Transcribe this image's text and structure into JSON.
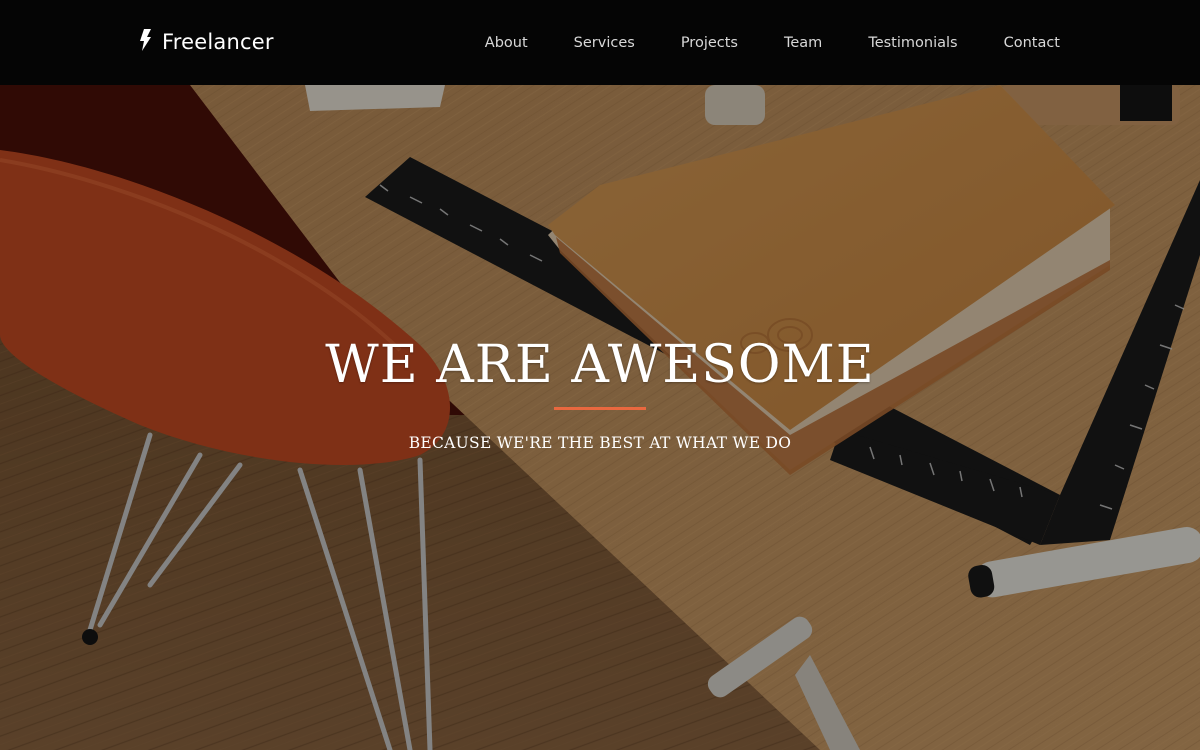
{
  "navbar": {
    "brand": {
      "icon": "lightning-bolt-icon",
      "name": "Freelancer"
    },
    "links": [
      {
        "label": "About"
      },
      {
        "label": "Services"
      },
      {
        "label": "Projects"
      },
      {
        "label": "Team"
      },
      {
        "label": "Testimonials"
      },
      {
        "label": "Contact"
      }
    ]
  },
  "hero": {
    "title": "WE ARE AWESOME",
    "subtitle": "BECAUSE WE'RE THE BEST AT WHAT WE DO",
    "divider_color": "#e9683f"
  },
  "colors": {
    "navbar_bg": "#050505",
    "accent": "#e9683f",
    "text": "#ffffff"
  }
}
